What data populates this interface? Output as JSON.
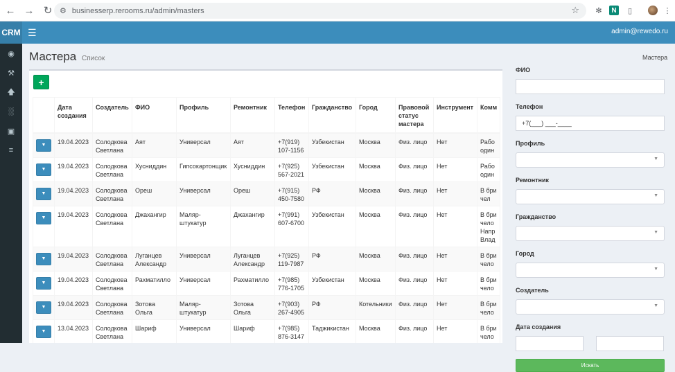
{
  "browser": {
    "url": "businesserp.rerooms.ru/admin/masters",
    "ext_n": "N"
  },
  "app": {
    "logo": "CRM",
    "user_email": "admin@rewedo.ru"
  },
  "page": {
    "title": "Мастера",
    "subtitle": "Список",
    "breadcrumb": "Мастера"
  },
  "table": {
    "add_label": "+",
    "columns": [
      "",
      "Дата создания",
      "Создатель",
      "ФИО",
      "Профиль",
      "Ремонтник",
      "Телефон",
      "Гражданство",
      "Город",
      "Правовой статус мастера",
      "Инструмент",
      "Комм"
    ],
    "rows": [
      [
        "",
        "19.04.2023",
        "Солодкова Светлана",
        "Аят",
        "Универсал",
        "Аят",
        "+7(919) 107-1156",
        "Узбекистан",
        "Москва",
        "Физ. лицо",
        "Нет",
        "Рабо один"
      ],
      [
        "",
        "19.04.2023",
        "Солодкова Светлана",
        "Хусниддин",
        "Гипсокартонщик",
        "Хусниддин",
        "+7(925) 567-2021",
        "Узбекистан",
        "Москва",
        "Физ. лицо",
        "Нет",
        "Рабо один"
      ],
      [
        "",
        "19.04.2023",
        "Солодкова Светлана",
        "Ореш",
        "Универсал",
        "Ореш",
        "+7(915) 450-7580",
        "РФ",
        "Москва",
        "Физ. лицо",
        "Нет",
        "В бри чел"
      ],
      [
        "",
        "19.04.2023",
        "Солодкова Светлана",
        "Джахангир",
        "Маляр-штукатур",
        "Джахангир",
        "+7(991) 607-6700",
        "Узбекистан",
        "Москва",
        "Физ. лицо",
        "Нет",
        "В бри чело Напр Влад"
      ],
      [
        "",
        "19.04.2023",
        "Солодкова Светлана",
        "Луганцев Александр",
        "Универсал",
        "Луганцев Александр",
        "+7(925) 119-7987",
        "РФ",
        "Москва",
        "Физ. лицо",
        "Нет",
        "В бри чело"
      ],
      [
        "",
        "19.04.2023",
        "Солодкова Светлана",
        "Рахматилло",
        "Универсал",
        "Рахматилло",
        "+7(985) 776-1705",
        "Узбекистан",
        "Москва",
        "Физ. лицо",
        "Нет",
        "В бри чело"
      ],
      [
        "",
        "19.04.2023",
        "Солодкова Светлана",
        "Зотова Ольга",
        "Маляр-штукатур",
        "Зотова Ольга",
        "+7(903) 267-4905",
        "РФ",
        "Котельники",
        "Физ. лицо",
        "Нет",
        "В бри чело"
      ],
      [
        "",
        "13.04.2023",
        "Солодкова Светлана",
        "Шариф",
        "Универсал",
        "Шариф",
        "+7(985) 876-3147",
        "Таджикистан",
        "Москва",
        "Физ. лицо",
        "Нет",
        "В бри чело"
      ]
    ]
  },
  "filters": {
    "fio_label": "ФИО",
    "phone_label": "Телефон",
    "phone_value": "+7(___) ___-____",
    "profile_label": "Профиль",
    "repairman_label": "Ремонтник",
    "citizenship_label": "Гражданство",
    "city_label": "Город",
    "creator_label": "Создатель",
    "date_label": "Дата создания",
    "search_label": "Искать"
  }
}
